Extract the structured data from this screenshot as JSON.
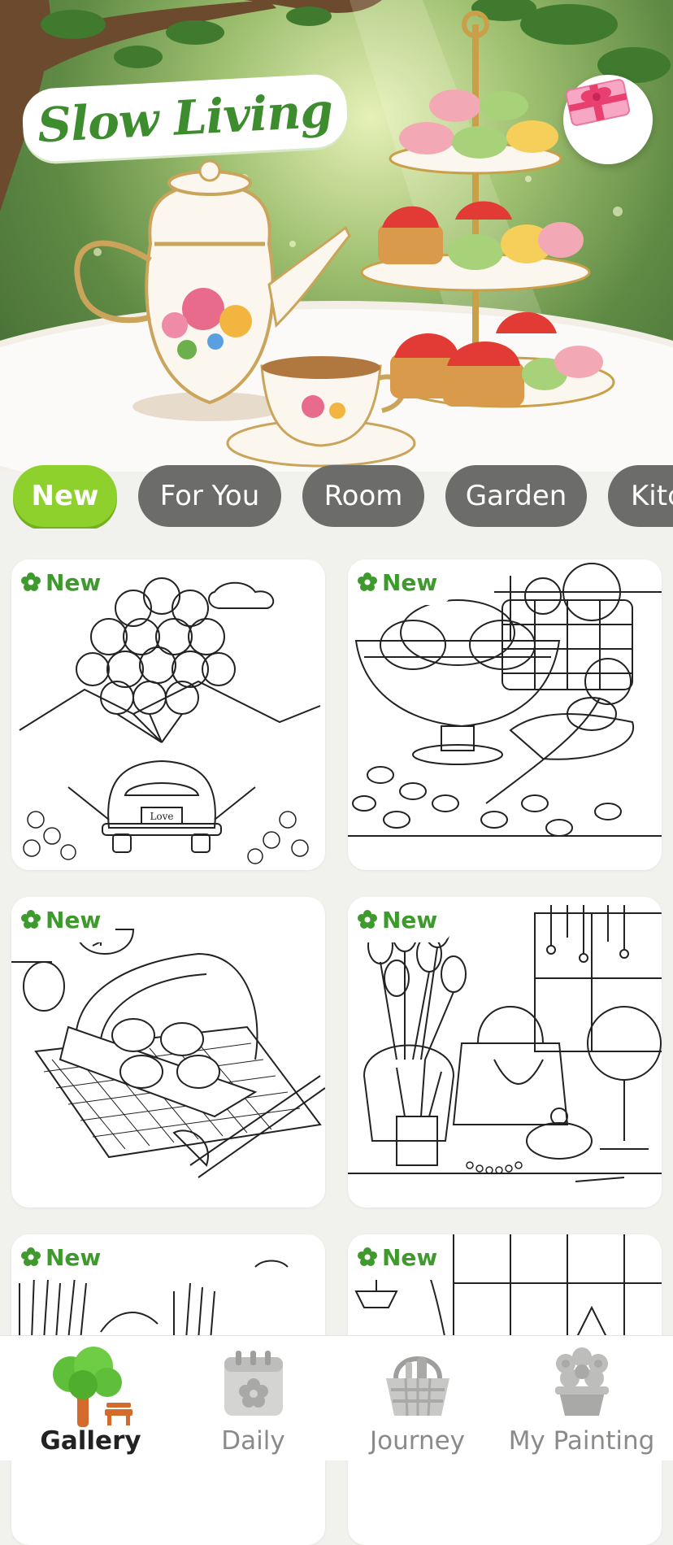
{
  "header": {
    "title": "Slow Living",
    "gift_icon": "gift-icon"
  },
  "tabs": [
    {
      "label": "New",
      "active": true
    },
    {
      "label": "For You",
      "active": false
    },
    {
      "label": "Room",
      "active": false
    },
    {
      "label": "Garden",
      "active": false
    },
    {
      "label": "Kitc",
      "active": false
    }
  ],
  "gallery": {
    "badge_label": "New",
    "badge_icon": "flower-icon",
    "items": [
      {
        "badge": "New",
        "art_label": "Love"
      },
      {
        "badge": "New"
      },
      {
        "badge": "New"
      },
      {
        "badge": "New"
      },
      {
        "badge": "New"
      },
      {
        "badge": "New"
      }
    ]
  },
  "bottom_nav": [
    {
      "label": "Gallery",
      "icon": "tree-icon",
      "active": true
    },
    {
      "label": "Daily",
      "icon": "calendar-icon",
      "active": false
    },
    {
      "label": "Journey",
      "icon": "basket-icon",
      "active": false
    },
    {
      "label": "My Painting",
      "icon": "flower-pot-icon",
      "active": false
    }
  ],
  "colors": {
    "accent": "#8fd12c",
    "tab_inactive": "#6c6c6a",
    "badge_text": "#3f9a2e",
    "background": "#f1f1ee"
  }
}
